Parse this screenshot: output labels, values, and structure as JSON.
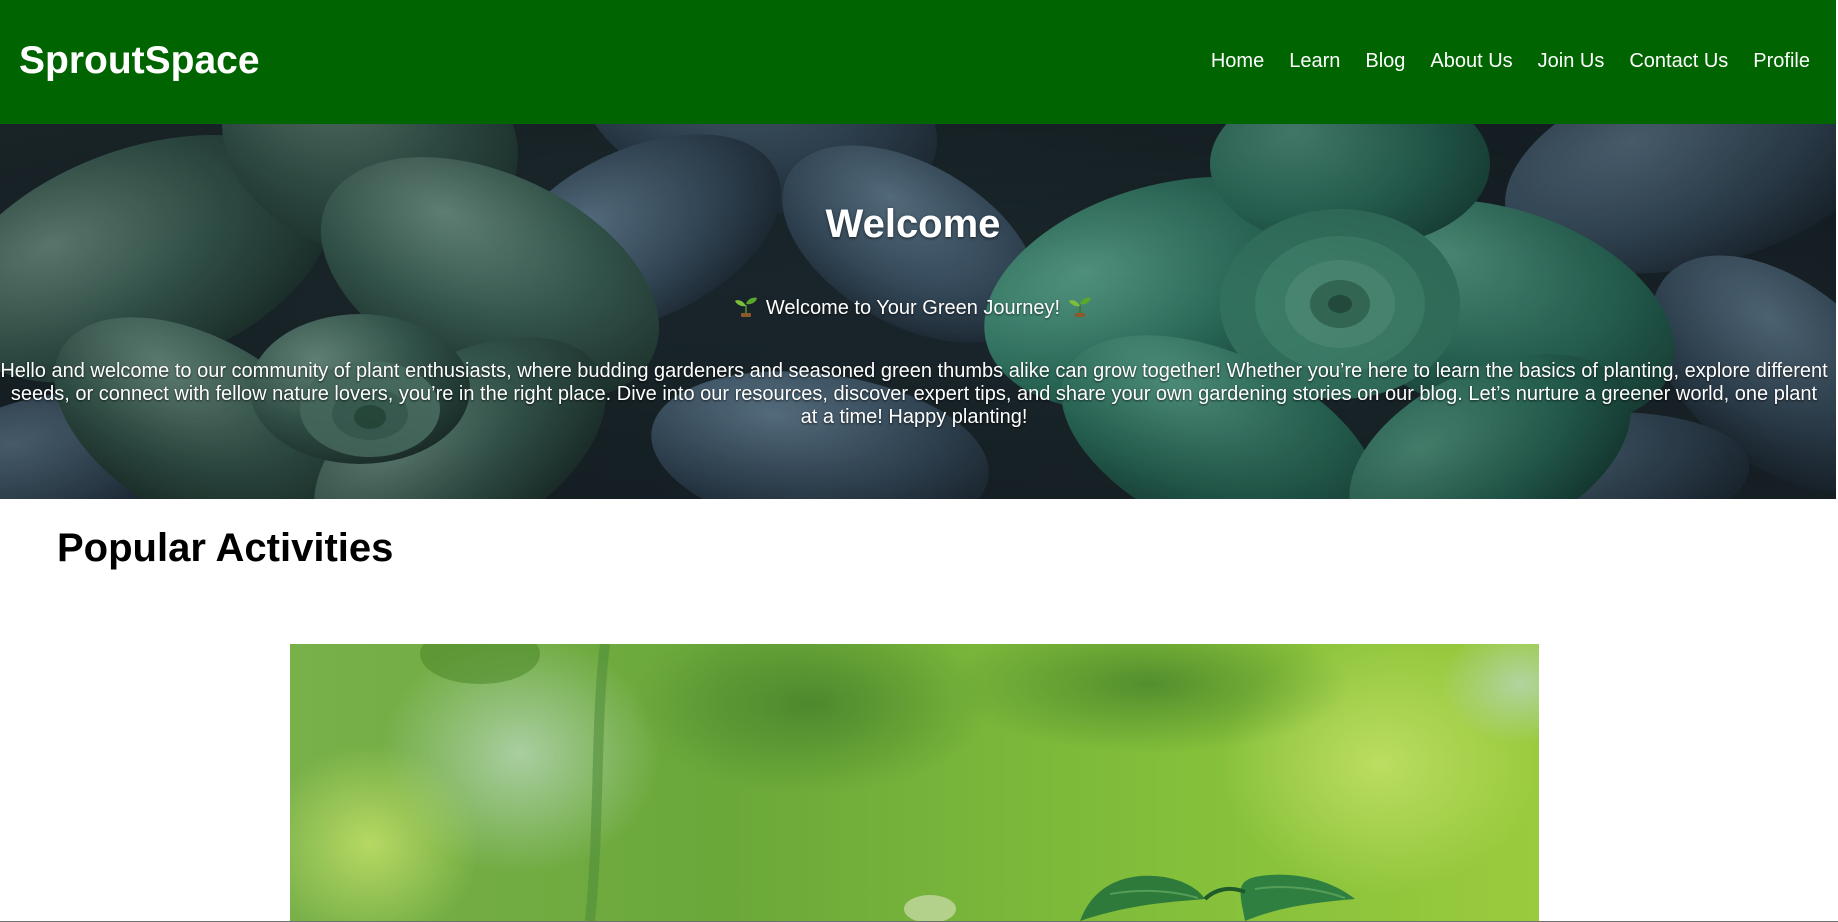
{
  "header": {
    "brand": "SproutSpace",
    "nav": [
      "Home",
      "Learn",
      "Blog",
      "About Us",
      "Join Us",
      "Contact Us",
      "Profile"
    ]
  },
  "hero": {
    "title": "Welcome",
    "subtitle": "Welcome to Your Green Journey!",
    "body": "Hello and welcome to our community of plant enthusiasts, where budding gardeners and seasoned green thumbs alike can grow together! Whether you’re here to learn the basics of planting, explore different seeds, or connect with fellow nature lovers, you’re in the right place. Dive into our resources, discover expert tips, and share your own gardening stories on our blog. Let’s nurture a greener world, one plant at a time! Happy planting!",
    "subtitle_icon": "seedling-icon"
  },
  "activities": {
    "title": "Popular Activities",
    "image": "seedling-photo"
  },
  "colors": {
    "header_bg": "#006400",
    "text_light": "#ffffff",
    "text_dark": "#000000"
  }
}
